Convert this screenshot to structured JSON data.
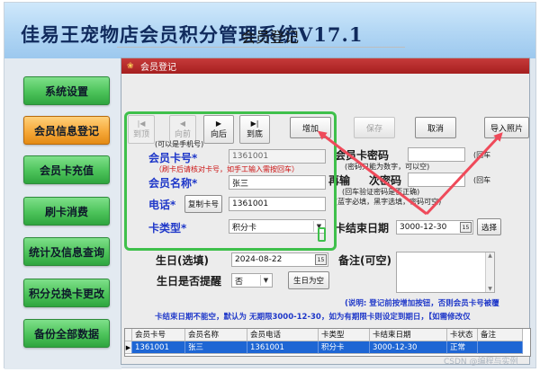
{
  "app": {
    "title": "佳易王宠物店会员积分管理系统V17.1"
  },
  "sidebar": {
    "items": [
      {
        "label": "系统设置",
        "active": false
      },
      {
        "label": "会员信息登记",
        "active": true
      },
      {
        "label": "会员卡充值",
        "active": false
      },
      {
        "label": "刷卡消费",
        "active": false
      },
      {
        "label": "统计及信息查询",
        "active": false
      },
      {
        "label": "积分兑换卡更改",
        "active": false
      },
      {
        "label": "备份全部数据",
        "active": false
      }
    ]
  },
  "window": {
    "title": "会员登记",
    "heading": "会员登记"
  },
  "nav_buttons": {
    "first": {
      "label": "到顶",
      "icon": "|◀"
    },
    "prev": {
      "label": "向前",
      "icon": "◀"
    },
    "next": {
      "label": "向后",
      "icon": "▶"
    },
    "last": {
      "label": "到底",
      "icon": "▶|"
    }
  },
  "actions": {
    "add": "增加",
    "save": "保存",
    "cancel": "取消",
    "import_photo": "导入照片"
  },
  "form": {
    "phone_hint": "(可以是手机号)",
    "card_no": {
      "label": "会员卡号*",
      "value": "1361001",
      "hint": "（刷卡后请核对卡号，如手工输入需按回车）"
    },
    "name": {
      "label": "会员名称*",
      "value": "张三"
    },
    "phone": {
      "label": "电话*",
      "copy_button": "复制卡号",
      "value": "1361001"
    },
    "card_type": {
      "label": "卡类型*",
      "value": "积分卡"
    },
    "card_pwd": {
      "label": "会员卡密码",
      "hint": "(密码只能为数字，可以空)",
      "enter": "(回车"
    },
    "confirm_pwd": {
      "label_prefix": "再输",
      "label": "次密码",
      "enter": "(回车",
      "hint": "(回车验证密码是否正确)"
    },
    "required_note": "(蓝字必填，黑字选填，密码可空)",
    "expire": {
      "label": "卡结束日期",
      "value": "3000-12-30",
      "select_button": "选择"
    },
    "birthday": {
      "label": "生日(选填)",
      "value": "2024-08-22"
    },
    "remind": {
      "label": "生日是否提醒",
      "value": "否",
      "button": "生日为空"
    },
    "notes": {
      "label": "备注(可空)"
    },
    "explain": "(说明: 登记前按增加按钮，否则会员卡号被覆",
    "expire_note": "卡结束日期不能空，默认为 无期限3000-12-30，如为有期限卡则设定到期日，【如需修改仅"
  },
  "table": {
    "columns": [
      "会员卡号",
      "会员名称",
      "会员电话",
      "卡类型",
      "卡结束日期",
      "卡状态",
      "备注"
    ],
    "rows": [
      [
        "1361001",
        "张三",
        "1361001",
        "积分卡",
        "3000-12-30",
        "正常",
        ""
      ]
    ]
  },
  "watermark": "CSDN @编程与实例",
  "colors": {
    "accent_green": "#3fc04b",
    "arrow_red": "#ef4a5a",
    "label_blue": "#1f38c9",
    "title_red": "#a51f1f"
  }
}
